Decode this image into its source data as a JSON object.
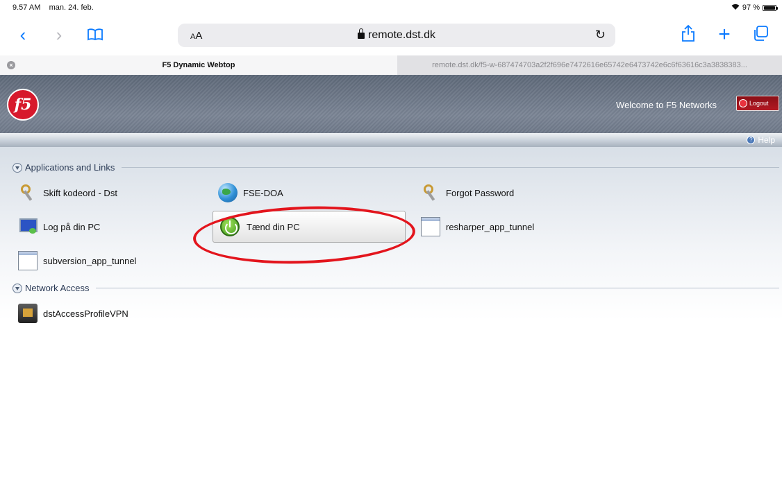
{
  "status_bar": {
    "time": "9.57 AM",
    "date": "man. 24. feb.",
    "battery": "97 %",
    "battery_level": 0.97
  },
  "toolbar": {
    "back_glyph": "‹",
    "forward_glyph": "›",
    "text_size_label": "AA",
    "url": "remote.dst.dk",
    "reload_glyph": "↻",
    "bookmarks_icon": "book-icon",
    "share_icon": "share-icon",
    "new_tab_glyph": "+",
    "tabs_icon": "tabs-icon"
  },
  "tabs": [
    {
      "title": "F5 Dynamic Webtop",
      "active": true
    },
    {
      "title": "remote.dst.dk/f5-w-687474703a2f2f696e7472616e65742e6473742e6c6f63616c3a3838383...",
      "active": false
    }
  ],
  "header": {
    "logo_text": "f5",
    "welcome": "Welcome to F5 Networks",
    "logout_label": "Logout",
    "help_label": "Help"
  },
  "sections": {
    "apps_title": "Applications and Links",
    "network_title": "Network Access"
  },
  "apps": [
    {
      "label": "Skift kodeord - Dst",
      "icon": "keys-icon"
    },
    {
      "label": "FSE-DOA",
      "icon": "globe-icon"
    },
    {
      "label": "Forgot Password",
      "icon": "keys-icon"
    },
    {
      "label": "Log på din PC",
      "icon": "remote-pc-icon"
    },
    {
      "label": "Tænd din PC",
      "icon": "power-icon"
    },
    {
      "label": "resharper_app_tunnel",
      "icon": "app-window-icon"
    },
    {
      "label": "subversion_app_tunnel",
      "icon": "app-window-icon"
    }
  ],
  "network": [
    {
      "label": "dstAccessProfileVPN",
      "icon": "vpn-icon"
    }
  ],
  "colors": {
    "accent": "#0a7aff",
    "f5_red": "#d7192c",
    "highlight": "#e3151d"
  }
}
